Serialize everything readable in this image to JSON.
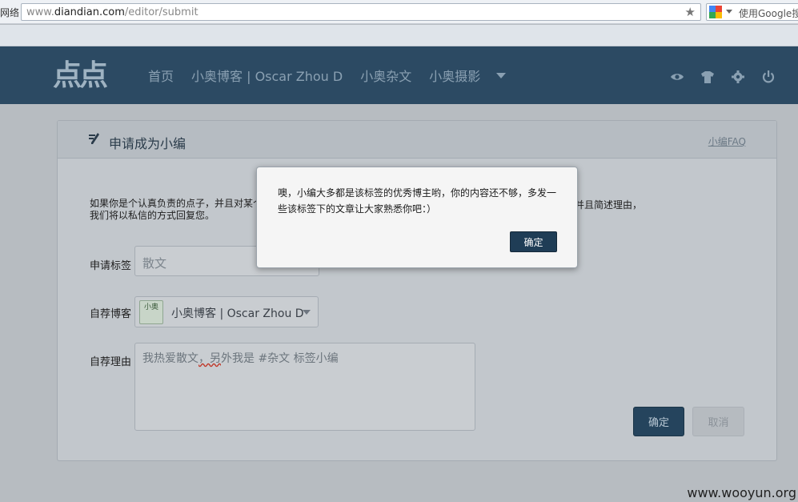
{
  "browser": {
    "left_stub": "网络",
    "url_scheme": "www.",
    "url_domain": "diandian.com",
    "url_path": "/editor/submit",
    "search_placeholder": "使用Google搜"
  },
  "header": {
    "logo": "点点",
    "nav": [
      "首页",
      "小奥博客 | Oscar Zhou D",
      "小奥杂文",
      "小奥摄影"
    ],
    "icons": [
      "eye-icon",
      "tshirt-icon",
      "gear-icon",
      "power-icon"
    ]
  },
  "panel": {
    "title": "申请成为小编",
    "faq": "小编FAQ",
    "intro_line1": "如果你是个认真负责的点子，并且对某个",
    "intro_line2": "我们将以私信的方式回复您。",
    "intro_tail": "并且简述理由，",
    "tag_label": "申请标签",
    "tag_value": "散文",
    "blog_label": "自荐博客",
    "blog_thumb": "小奥",
    "blog_value": "小奥博客 | Oscar Zhou D",
    "reason_label": "自荐理由",
    "reason_value_pre": "我热爱散文",
    "reason_value_mark": "，另",
    "reason_value_post": "外我是 #杂文 标签小编",
    "submit": "确定",
    "cancel": "取消"
  },
  "modal": {
    "message": "噢，小编大多都是该标签的优秀博主哟，你的内容还不够，多发一些该标签下的文章让大家熟悉你吧：）",
    "ok": "确定"
  },
  "watermark": "www.wooyun.org",
  "colors": {
    "header_bg": "#2c4a63",
    "primary_button": "#25445d",
    "overlay": "#b7bcc1"
  }
}
